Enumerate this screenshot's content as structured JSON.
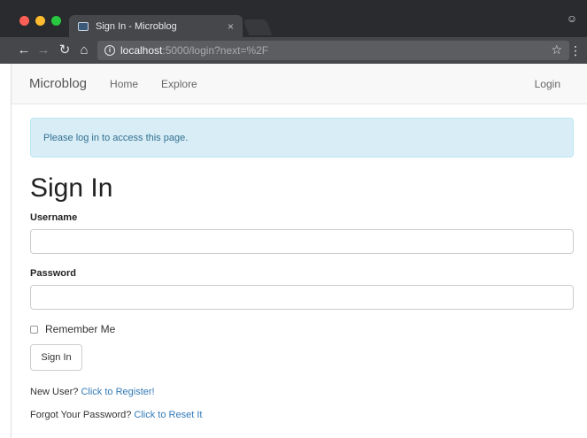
{
  "browser": {
    "tab_title": "Sign In - Microblog",
    "tab_close": "×",
    "url_host": "localhost",
    "url_rest": ":5000/login?next=%2F",
    "icons": [
      "back-icon",
      "forward-icon",
      "reload-icon",
      "home-icon",
      "info-icon",
      "star-icon",
      "menu-icon",
      "user-icon"
    ]
  },
  "navbar": {
    "brand": "Microblog",
    "links": [
      "Home",
      "Explore"
    ],
    "right_link": "Login"
  },
  "alert": {
    "message": "Please log in to access this page."
  },
  "form": {
    "title": "Sign In",
    "username_label": "Username",
    "password_label": "Password",
    "remember_label": "Remember Me",
    "submit_label": "Sign In"
  },
  "footer": {
    "new_user_prefix": "New User?",
    "register_link": "Click to Register!",
    "forgot_prefix": "Forgot Your Password?",
    "reset_link": "Click to Reset It"
  },
  "colors": {
    "alert_bg": "#d9edf7",
    "alert_text": "#31708f",
    "link": "#337ab7",
    "navbar_bg": "#f8f8f8"
  }
}
